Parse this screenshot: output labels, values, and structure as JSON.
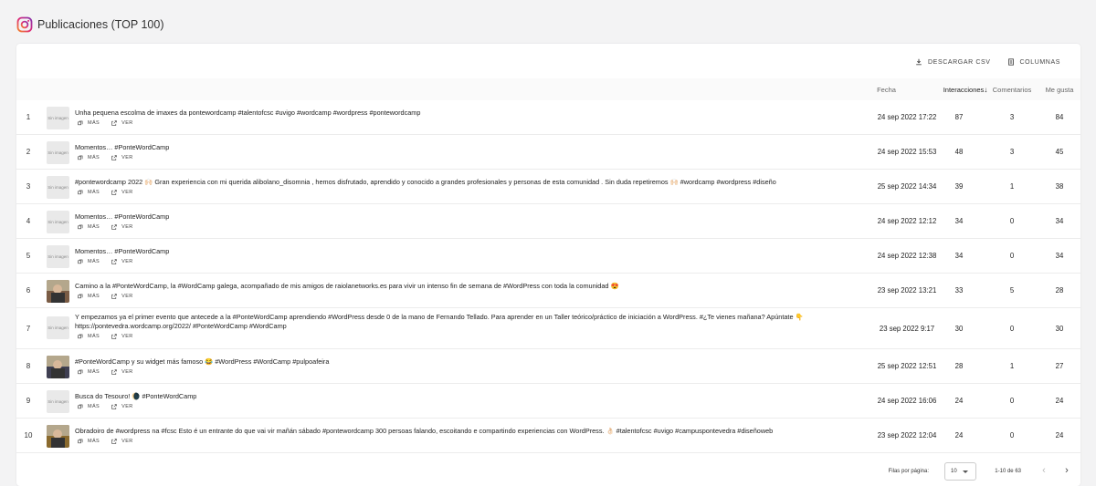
{
  "header": {
    "title": "Publicaciones (TOP 100)"
  },
  "toolbar": {
    "download_label": "DESCARGAR CSV",
    "columns_label": "COLUMNAS"
  },
  "columns": {
    "date": "Fecha",
    "interactions": "Interacciones",
    "interactions_sort": "descending",
    "comments": "Comentarios",
    "likes": "Me gusta"
  },
  "no_image_label": "Sin imagen",
  "actions": {
    "more": "MÁS",
    "view": "VER"
  },
  "posts": [
    {
      "rank": "1",
      "has_image": false,
      "text": "Unha pequena escolma de imaxes da pontewordcamp #talentofcsc #uvigo #wordcamp #wordpress #pontewordcamp",
      "date": "24 sep 2022 17:22",
      "interactions": "87",
      "comments": "3",
      "likes": "84"
    },
    {
      "rank": "2",
      "has_image": false,
      "text": "Momentos… #PonteWordCamp",
      "date": "24 sep 2022 15:53",
      "interactions": "48",
      "comments": "3",
      "likes": "45"
    },
    {
      "rank": "3",
      "has_image": false,
      "text": "#pontewordcamp 2022 🙌🏻 Gran experiencia con mi querida alibolano_disomnia , hemos disfrutado, aprendido y conocido a grandes profesionales y personas de esta comunidad . Sin duda repetiremos 🙌🏻 #wordcamp #wordpress #diseño",
      "date": "25 sep 2022 14:34",
      "interactions": "39",
      "comments": "1",
      "likes": "38"
    },
    {
      "rank": "4",
      "has_image": false,
      "text": "Momentos… #PonteWordCamp",
      "date": "24 sep 2022 12:12",
      "interactions": "34",
      "comments": "0",
      "likes": "34"
    },
    {
      "rank": "5",
      "has_image": false,
      "text": "Momentos… #PonteWordCamp",
      "date": "24 sep 2022 12:38",
      "interactions": "34",
      "comments": "0",
      "likes": "34"
    },
    {
      "rank": "6",
      "has_image": true,
      "text": "Camino a la #PonteWordCamp, la #WordCamp galega, acompañado de mis amigos de raiolanetworks.es para vivir un intenso fin de semana de #WordPress con toda la comunidad 😍",
      "date": "23 sep 2022 13:21",
      "interactions": "33",
      "comments": "5",
      "likes": "28"
    },
    {
      "rank": "7",
      "has_image": false,
      "text": "Y empezamos ya el primer evento que antecede a la #PonteWordCamp aprendiendo #WordPress desde 0 de la mano de Fernando Tellado. Para aprender en un Taller teórico/práctico de iniciación a WordPress. #¿Te vienes mañana? Apúntate 👇 https://pontevedra.wordcamp.org/2022/ #PonteWordCamp #WordCamp",
      "date": "23 sep 2022 9:17",
      "interactions": "30",
      "comments": "0",
      "likes": "30"
    },
    {
      "rank": "8",
      "has_image": true,
      "text": "#PonteWordCamp y su widget más famoso 😂 #WordPress #WordCamp #pulpoafeira",
      "date": "25 sep 2022 12:51",
      "interactions": "28",
      "comments": "1",
      "likes": "27"
    },
    {
      "rank": "9",
      "has_image": false,
      "text": "Busca do Tesouro! 🌘 #PonteWordCamp",
      "date": "24 sep 2022 16:06",
      "interactions": "24",
      "comments": "0",
      "likes": "24"
    },
    {
      "rank": "10",
      "has_image": true,
      "text": "Obradoiro de #wordpress na #fcsc Esto é un entrante do que vai vir mañán sábado #pontewordcamp 300 persoas falando, escoitando e compartindo experiencias con WordPress. 👌🏻 #talentofcsc #uvigo #campuspontevedra #diseñoweb",
      "date": "23 sep 2022 12:04",
      "interactions": "24",
      "comments": "0",
      "likes": "24"
    }
  ],
  "pagination": {
    "rows_per_page_label": "Filas por página:",
    "rows_per_page_value": "10",
    "range": "1-10 de 63"
  },
  "colors": {
    "accent": "#c13584"
  }
}
